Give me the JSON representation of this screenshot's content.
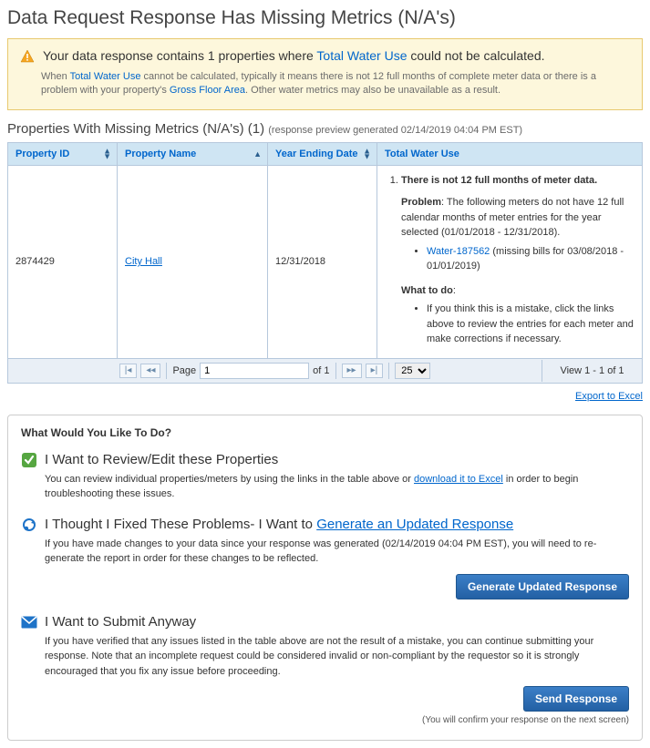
{
  "page_title": "Data Request Response Has Missing Metrics (N/A's)",
  "alert": {
    "prefix": "Your data response contains 1 properties where ",
    "metric_link": "Total Water Use",
    "suffix": " could not be calculated.",
    "body_pre": "When ",
    "body_link1": "Total Water Use",
    "body_mid": " cannot be calculated, typically it means there is not 12 full months of complete meter data or there is a problem with your property's ",
    "body_link2": "Gross Floor Area",
    "body_post": ". Other water metrics may also be unavailable as a result."
  },
  "section": {
    "title_pre": "Properties With Missing Metrics (N/A's) (1) ",
    "title_sub": "(response preview generated 02/14/2019 04:04 PM EST)"
  },
  "columns": {
    "c1": "Property ID",
    "c2": "Property Name",
    "c3": "Year Ending Date",
    "c4": "Total Water Use"
  },
  "row": {
    "property_id": "2874429",
    "property_name": "City Hall",
    "year_ending": "12/31/2018",
    "issue_title": "There is not 12 full months of meter data.",
    "problem_label": "Problem",
    "problem_text": ": The following meters do not have 12 full calendar months of meter entries for the year selected (01/01/2018 - 12/31/2018).",
    "meter_link": "Water-187562",
    "meter_text": " (missing bills for 03/08/2018 - 01/01/2019)",
    "whattodo_label": "What to do",
    "whattodo_text": "If you think this is a mistake, click the links above to review the entries for each meter and make corrections if necessary."
  },
  "pager": {
    "page_label": "Page",
    "page_value": "1",
    "of_label": "of 1",
    "per_page": "25",
    "view_text": "View 1 - 1 of 1"
  },
  "export_link": "Export to Excel",
  "panel": {
    "heading": "What Would You Like To Do?",
    "opt1": {
      "title": "I Want to Review/Edit these Properties",
      "body_pre": "You can review individual properties/meters by using the links in the table above or ",
      "body_link": "download it to Excel",
      "body_post": " in order to begin troubleshooting these issues."
    },
    "opt2": {
      "title_pre": "I Thought I Fixed These Problems- I Want to ",
      "title_link": "Generate an Updated Response",
      "body": "If you have made changes to your data since your response was generated (02/14/2019 04:04 PM EST), you will need to re-generate the report in order for these changes to be reflected.",
      "button": "Generate Updated Response"
    },
    "opt3": {
      "title": "I Want to Submit Anyway",
      "body": "If you have verified that any issues listed in the table above are not the result of a mistake, you can continue submitting your response. Note that an incomplete request could be considered invalid or non-compliant by the requestor so it is strongly encouraged that you fix any issue before proceeding.",
      "button": "Send Response",
      "note": "(You will confirm your response on the next screen)"
    }
  }
}
